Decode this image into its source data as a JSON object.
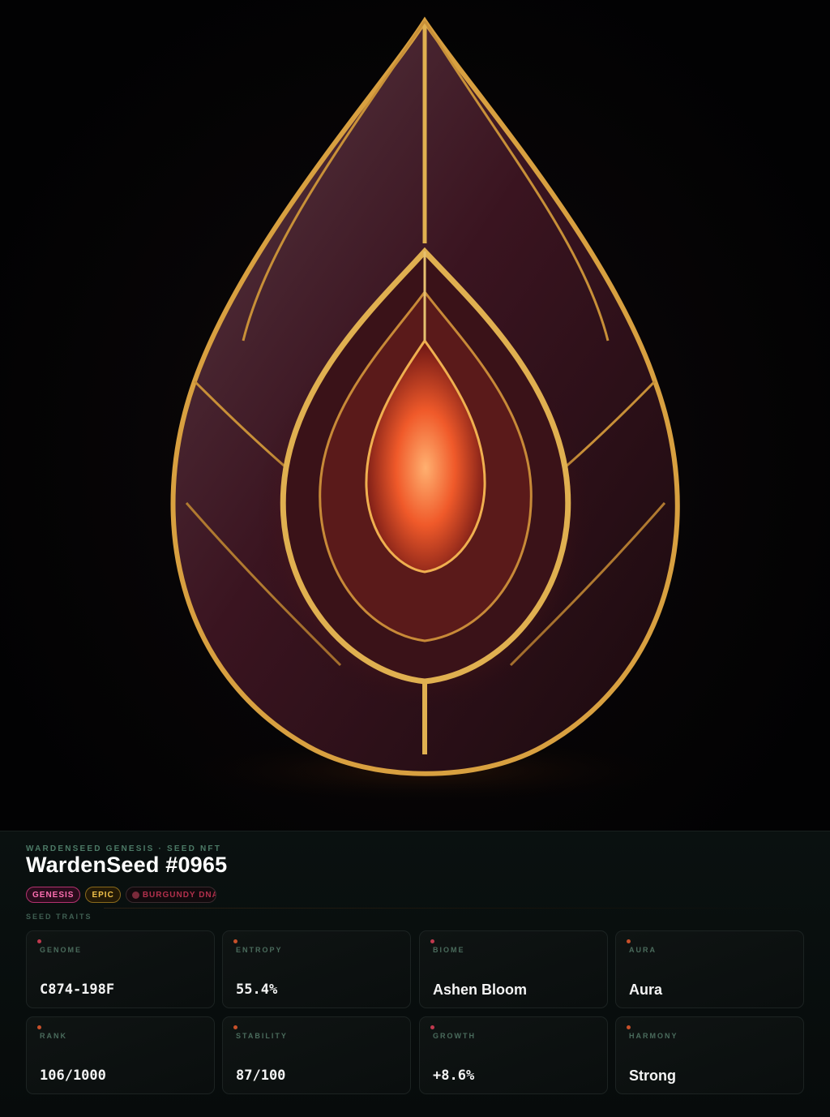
{
  "hero": {
    "image_alt": "faceted burgundy seed gem with gold filigree and glowing core"
  },
  "header": {
    "eyebrow": "WARDENSEED GENESIS · SEED NFT",
    "title": "WardenSeed #0965"
  },
  "badges": [
    {
      "label": "GENESIS"
    },
    {
      "label": "EPIC"
    },
    {
      "label": "BURGUNDY DNA"
    }
  ],
  "traits_label": "SEED TRAITS",
  "traits": [
    {
      "label": "GENOME",
      "value": "C874-198F"
    },
    {
      "label": "ENTROPY",
      "value": "55.4%"
    },
    {
      "label": "BIOME",
      "value": "Ashen Bloom"
    },
    {
      "label": "AURA",
      "value": "Aura"
    },
    {
      "label": "RANK",
      "value": "106/1000"
    },
    {
      "label": "STABILITY",
      "value": "87/100"
    },
    {
      "label": "GROWTH",
      "value": "+8.6%"
    },
    {
      "label": "HARMONY",
      "value": "Strong"
    }
  ],
  "colors": {
    "genesis": "#ff6fb2",
    "epic": "#f2c24a",
    "dna": "#b2304c",
    "accent_green": "#4c7a66"
  }
}
